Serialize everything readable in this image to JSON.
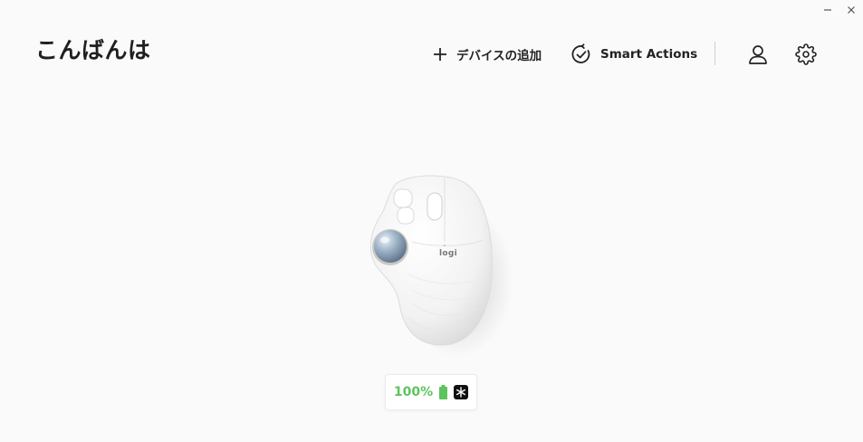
{
  "window": {
    "minimize_label": "–",
    "close_label": "×"
  },
  "header": {
    "greeting": "こんばんは",
    "add_device_label": "デバイスの追加",
    "smart_actions_label": "Smart Actions"
  },
  "device": {
    "logo_text": "logi",
    "battery_percent": 100,
    "battery_label": "100%",
    "connection_icon": "bluetooth-icon"
  },
  "colors": {
    "background": "#fafafa",
    "battery_green": "#5cc45e",
    "text": "#1f1f1f"
  }
}
